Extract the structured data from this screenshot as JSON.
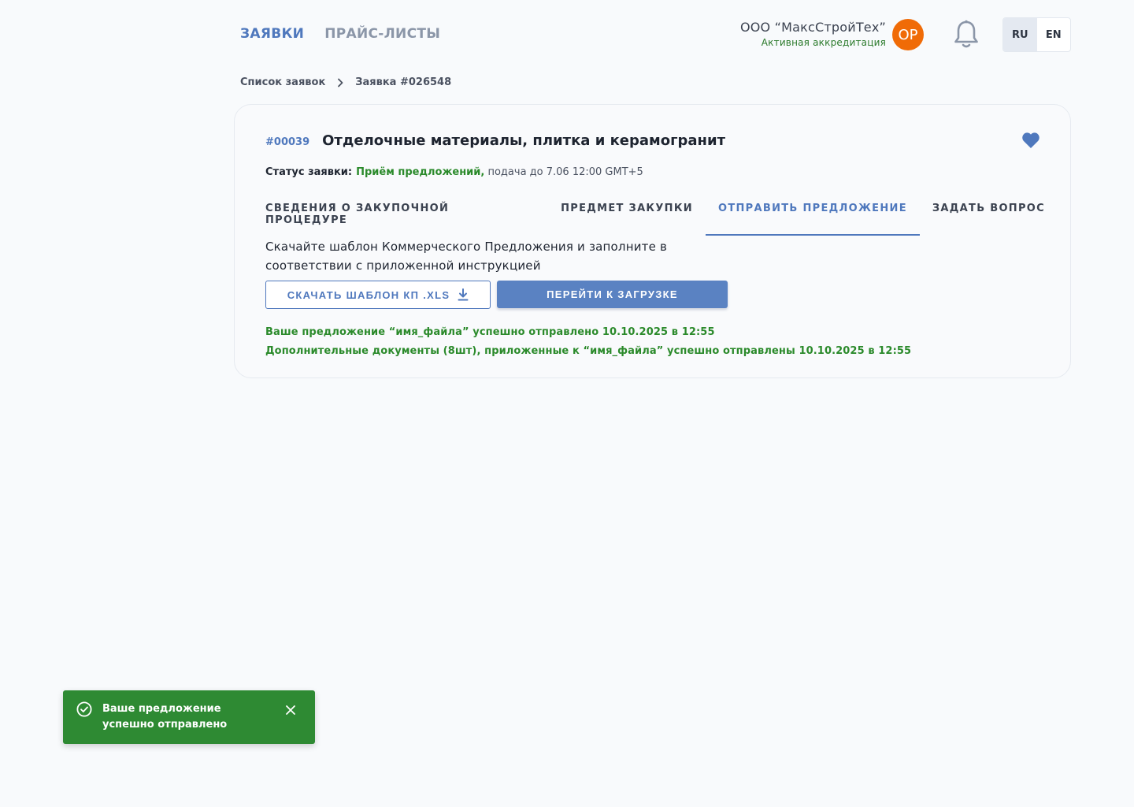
{
  "nav": {
    "items": [
      {
        "label": "ЗАЯВКИ",
        "active": true
      },
      {
        "label": "ПРАЙС-ЛИСТЫ",
        "active": false
      }
    ]
  },
  "header": {
    "org_name": "ООО “МаксСтройТех”",
    "org_status": "Активная аккредитация",
    "avatar_initials": "OP",
    "languages": [
      "RU",
      "EN"
    ],
    "selected_language": "RU"
  },
  "breadcrumb": {
    "parent": "Список заявок",
    "current": "Заявка #026548"
  },
  "request": {
    "id": "#00039",
    "title": "Отделочные материалы, плитка и керамогранит",
    "status_label": "Статус заявки:",
    "status_value": "Приём предложений,",
    "status_deadline": " подача до 7.06 12:00 GMT+5"
  },
  "tabs": [
    {
      "label": "СВЕДЕНИЯ О ЗАКУПОЧНОЙ ПРОЦЕДУРЕ",
      "active": false
    },
    {
      "label": "ПРЕДМЕТ ЗАКУПКИ",
      "active": false
    },
    {
      "label": "ОТПРАВИТЬ ПРЕДЛОЖЕНИЕ",
      "active": true
    },
    {
      "label": "ЗАДАТЬ ВОПРОС",
      "active": false
    }
  ],
  "offer": {
    "instruction": "Скачайте шаблон Коммерческого Предложения и заполните в соответствии с приложенной инструкцией",
    "download_label": "СКАЧАТЬ ШАБЛОН КП .XLS",
    "upload_label": "ПЕРЕЙТИ К ЗАГРУЗКЕ",
    "message_1": "Ваше предложение “имя_файла” успешно отправлено 10.10.2025 в 12:55",
    "message_2": "Дополнительные документы (8шт), приложенные к “имя_файла” успешно отправлены  10.10.2025 в 12:55"
  },
  "toast": {
    "text": "Ваше предложение успешно отправлено"
  },
  "colors": {
    "accent": "#4f78bd",
    "success": "#2e8a33",
    "avatar": "#f06b07"
  }
}
